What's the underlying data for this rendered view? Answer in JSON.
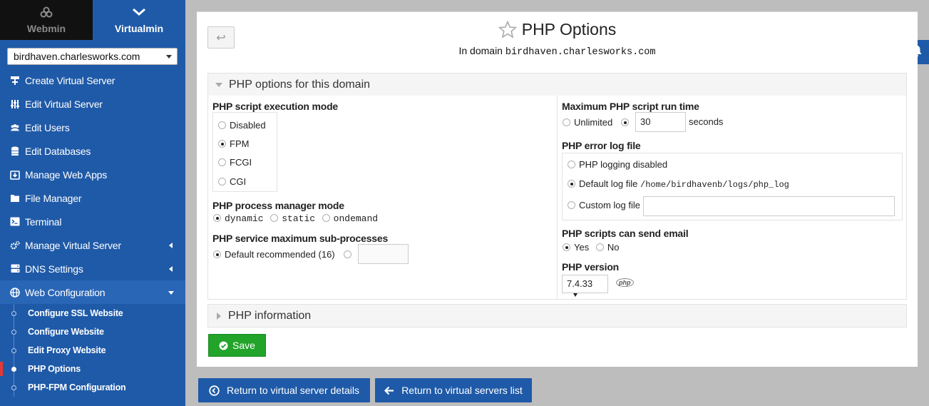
{
  "brand": {
    "webmin": "Webmin",
    "virtualmin": "Virtualmin"
  },
  "domain_selector": {
    "value": "birdhaven.charlesworks.com"
  },
  "sidebar": {
    "items": [
      {
        "label": "Create Virtual Server",
        "icon": "server-plus-icon"
      },
      {
        "label": "Edit Virtual Server",
        "icon": "sliders-icon"
      },
      {
        "label": "Edit Users",
        "icon": "users-icon"
      },
      {
        "label": "Edit Databases",
        "icon": "database-icon"
      },
      {
        "label": "Manage Web Apps",
        "icon": "download-box-icon"
      },
      {
        "label": "File Manager",
        "icon": "folder-icon"
      },
      {
        "label": "Terminal",
        "icon": "terminal-icon"
      },
      {
        "label": "Manage Virtual Server",
        "icon": "cogs-icon"
      },
      {
        "label": "DNS Settings",
        "icon": "server-icon"
      },
      {
        "label": "Web Configuration",
        "icon": "globe-icon"
      }
    ],
    "subitems": [
      {
        "label": "Configure SSL Website"
      },
      {
        "label": "Configure Website"
      },
      {
        "label": "Edit Proxy Website"
      },
      {
        "label": "PHP Options"
      },
      {
        "label": "PHP-FPM Configuration"
      }
    ]
  },
  "header": {
    "title": "PHP Options",
    "subtitle_prefix": "In domain",
    "subtitle_domain": "birdhaven.charlesworks.com"
  },
  "options_section": {
    "title": "PHP options for this domain",
    "execution_mode": {
      "label": "PHP script execution mode",
      "options": [
        "Disabled",
        "FPM",
        "FCGI",
        "CGI"
      ],
      "selected": "FPM"
    },
    "process_manager": {
      "label": "PHP process manager mode",
      "options": [
        "dynamic",
        "static",
        "ondemand"
      ],
      "selected": "dynamic"
    },
    "max_subprocesses": {
      "label": "PHP service maximum sub-processes",
      "default_label": "Default recommended (16)",
      "custom_value": ""
    },
    "max_run_time": {
      "label": "Maximum PHP script run time",
      "unlimited_label": "Unlimited",
      "value": "30",
      "unit": "seconds"
    },
    "error_log": {
      "label": "PHP error log file",
      "disabled_label": "PHP logging disabled",
      "default_label": "Default log file",
      "default_path": "/home/birdhavenb/logs/php_log",
      "custom_label": "Custom log file",
      "custom_value": ""
    },
    "send_email": {
      "label": "PHP scripts can send email",
      "yes": "Yes",
      "no": "No"
    },
    "version": {
      "label": "PHP version",
      "value": "7.4.33",
      "logo": "php"
    }
  },
  "info_section": {
    "title": "PHP information"
  },
  "buttons": {
    "save": "Save",
    "return_details": "Return to virtual server details",
    "return_list": "Return to virtual servers list"
  },
  "colors": {
    "sidebar": "#1f5aa8",
    "save": "#22a32a",
    "active_marker": "#e53935"
  }
}
